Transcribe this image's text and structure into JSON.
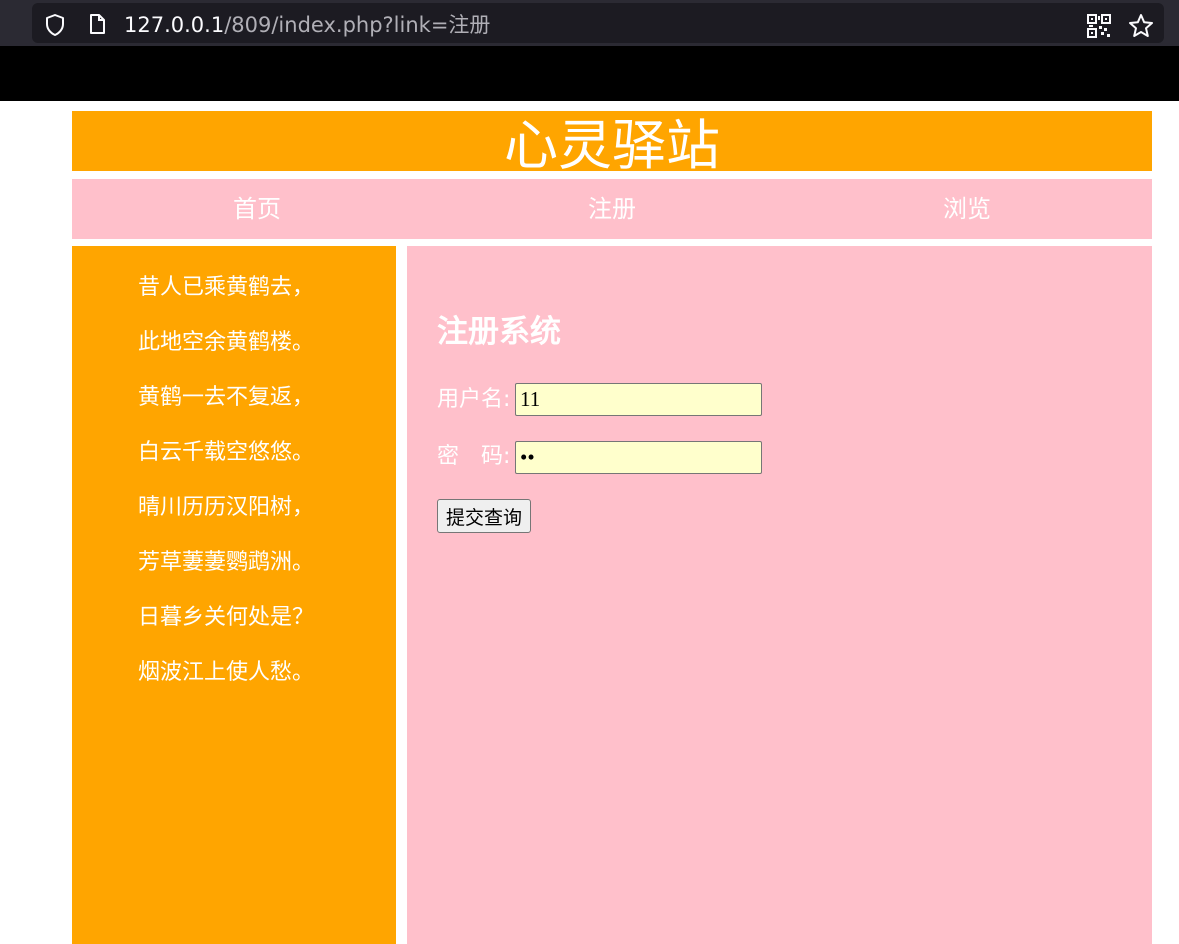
{
  "browser": {
    "url_host": "127.0.0.1",
    "url_rest": "/809/index.php?link=注册"
  },
  "header": {
    "title": "心灵驿站"
  },
  "nav": {
    "items": [
      {
        "label": "首页"
      },
      {
        "label": "注册"
      },
      {
        "label": "浏览"
      }
    ]
  },
  "sidebar": {
    "poem": [
      "昔人已乘黄鹤去，",
      "此地空余黄鹤楼。",
      "黄鹤一去不复返，",
      "白云千载空悠悠。",
      "晴川历历汉阳树，",
      "芳草萋萋鹦鹉洲。",
      "日暮乡关何处是？",
      "烟波江上使人愁。"
    ]
  },
  "form": {
    "title": "注册系统",
    "username_label": "用户名:",
    "username_value": "11",
    "password_label": "密　码:",
    "password_value": "11",
    "submit_label": "提交查询"
  },
  "colors": {
    "header_bg": "#ffa500",
    "nav_bg": "#ffc0cb",
    "sidebar_bg": "#ffa500",
    "main_bg": "#ffc0cb",
    "input_bg": "#ffffcc"
  }
}
